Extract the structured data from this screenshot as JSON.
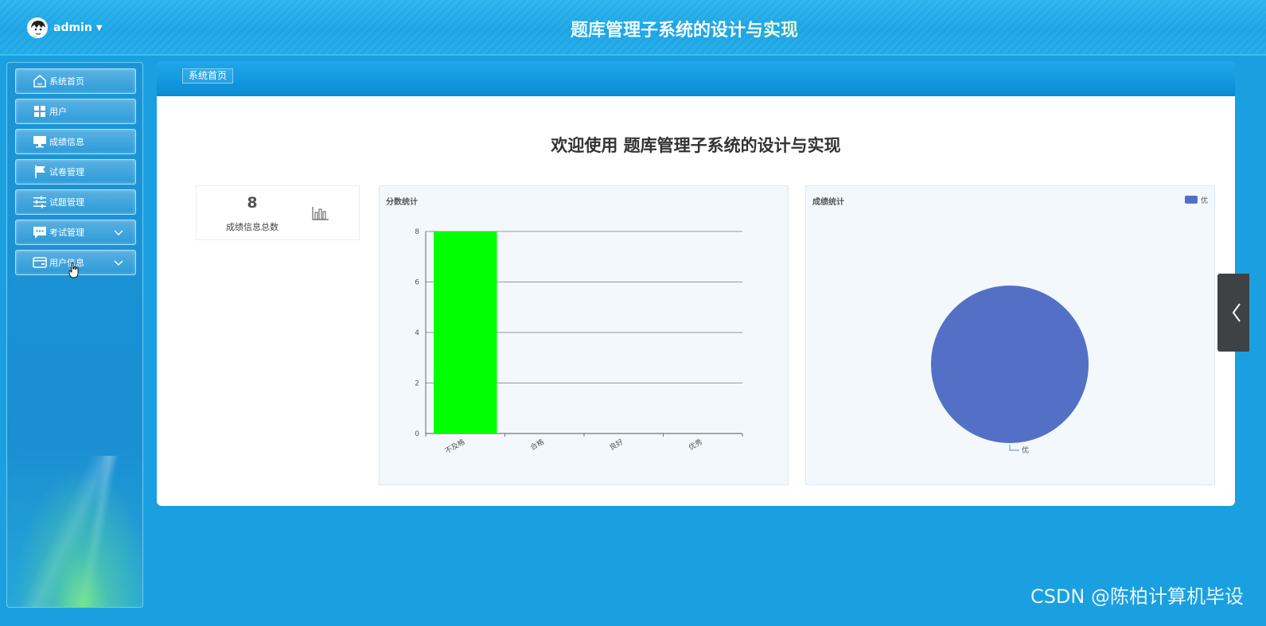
{
  "header": {
    "username": "admin",
    "app_title": "题库管理子系统的设计与实现"
  },
  "sidebar": {
    "items": [
      {
        "label": "系统首页",
        "icon": "home-icon",
        "has_submenu": false
      },
      {
        "label": "用户",
        "icon": "grid-icon",
        "has_submenu": false
      },
      {
        "label": "成绩信息",
        "icon": "monitor-icon",
        "has_submenu": false
      },
      {
        "label": "试卷管理",
        "icon": "flag-icon",
        "has_submenu": false
      },
      {
        "label": "试题管理",
        "icon": "sliders-icon",
        "has_submenu": false
      },
      {
        "label": "考试管理",
        "icon": "chat-icon",
        "has_submenu": true
      },
      {
        "label": "用户信息",
        "icon": "card-icon",
        "has_submenu": true
      }
    ]
  },
  "breadcrumb": "系统首页",
  "main": {
    "welcome": "欢迎使用 题库管理子系统的设计与实现",
    "stat": {
      "value": "8",
      "label": "成绩信息总数",
      "icon": "bar-chart-icon"
    }
  },
  "watermark": "CSDN @陈柏计算机毕设",
  "colors": {
    "bar": "#00ff00",
    "pie": "#5470c6",
    "accent": "#1aa0e0"
  },
  "chart_data": [
    {
      "type": "bar",
      "title": "分数统计",
      "categories": [
        "不及格",
        "合格",
        "良好",
        "优秀"
      ],
      "values": [
        8,
        0,
        0,
        0
      ],
      "ylim": [
        0,
        8
      ],
      "yticks": [
        0,
        2,
        4,
        6,
        8
      ],
      "grid": true
    },
    {
      "type": "pie",
      "title": "成绩统计",
      "labels": [
        "优"
      ],
      "values": [
        8
      ],
      "legend": {
        "position": "top-right",
        "entries": [
          "优"
        ]
      }
    }
  ]
}
